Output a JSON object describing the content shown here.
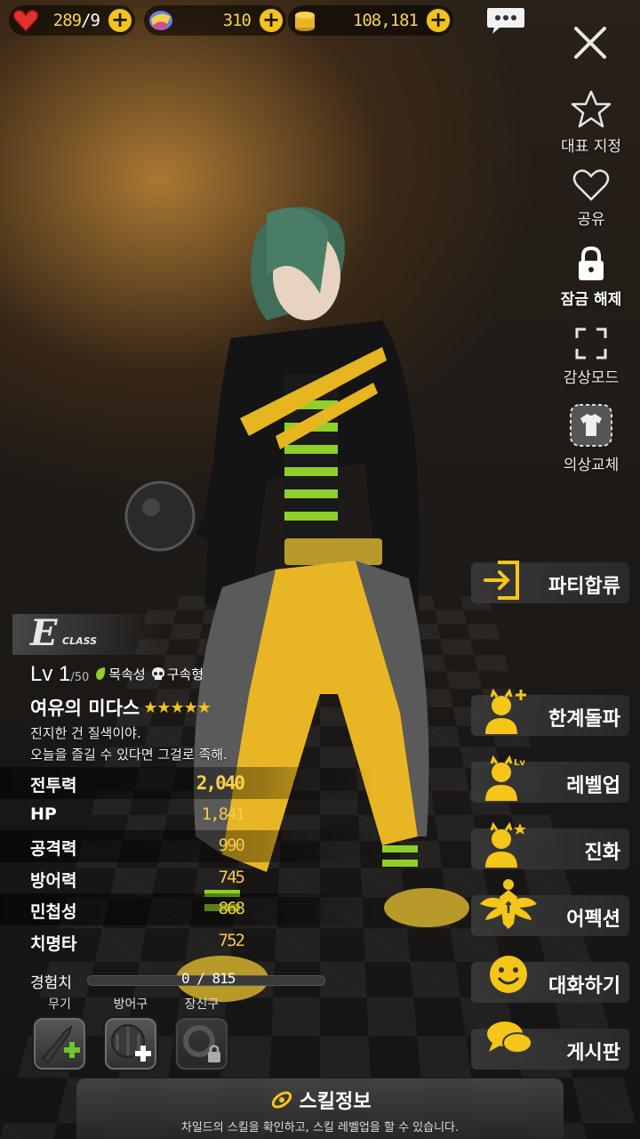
{
  "currencies": [
    {
      "name": "stamina",
      "icon": "heart-icon",
      "value": "289",
      "max": "9"
    },
    {
      "name": "gems",
      "icon": "gem-icon",
      "value": "310"
    },
    {
      "name": "gold",
      "icon": "gold-coins-icon",
      "value": "108,181"
    }
  ],
  "side_menu": {
    "representative": "대표 지정",
    "share": "공유",
    "unlock": "잠금 해제",
    "view_mode": "감상모드",
    "costume": "의상교체"
  },
  "actions": {
    "party": "파티합류",
    "limit_break": "한계돌파",
    "level_up": "레벨업",
    "evolve": "진화",
    "affection": "어펙션",
    "talk": "대화하기",
    "board": "게시판"
  },
  "character": {
    "class_letter": "E",
    "class_word": "CLASS",
    "level": "Lv 1",
    "level_max": "/50",
    "attribute": "목속성",
    "type": "구속형",
    "name": "여유의 미다스",
    "star_count": 5,
    "stars": "★★★★★",
    "quote_line1": "진지한 건 질색이야.",
    "quote_line2": "오늘을 즐길 수 있다면 그걸로 족해."
  },
  "stats": [
    {
      "label": "전투력",
      "value": "2,040"
    },
    {
      "label": "HP",
      "value": "1,841"
    },
    {
      "label": "공격력",
      "value": "990"
    },
    {
      "label": "방어력",
      "value": "745"
    },
    {
      "label": "민첩성",
      "value": "868"
    },
    {
      "label": "치명타",
      "value": "752"
    }
  ],
  "experience": {
    "label": "경험치",
    "value": "0 / 815",
    "progress": 0
  },
  "equipment": [
    {
      "label": "무기"
    },
    {
      "label": "방어구"
    },
    {
      "label": "장신구"
    }
  ],
  "skill_info": {
    "title": "스킬정보",
    "desc": "차일드의 스킬을 확인하고, 스킬 레벨업을 할 수 있습니다."
  },
  "colors": {
    "accent_gold": "#f5c518",
    "value_gold": "#f5c94a"
  }
}
